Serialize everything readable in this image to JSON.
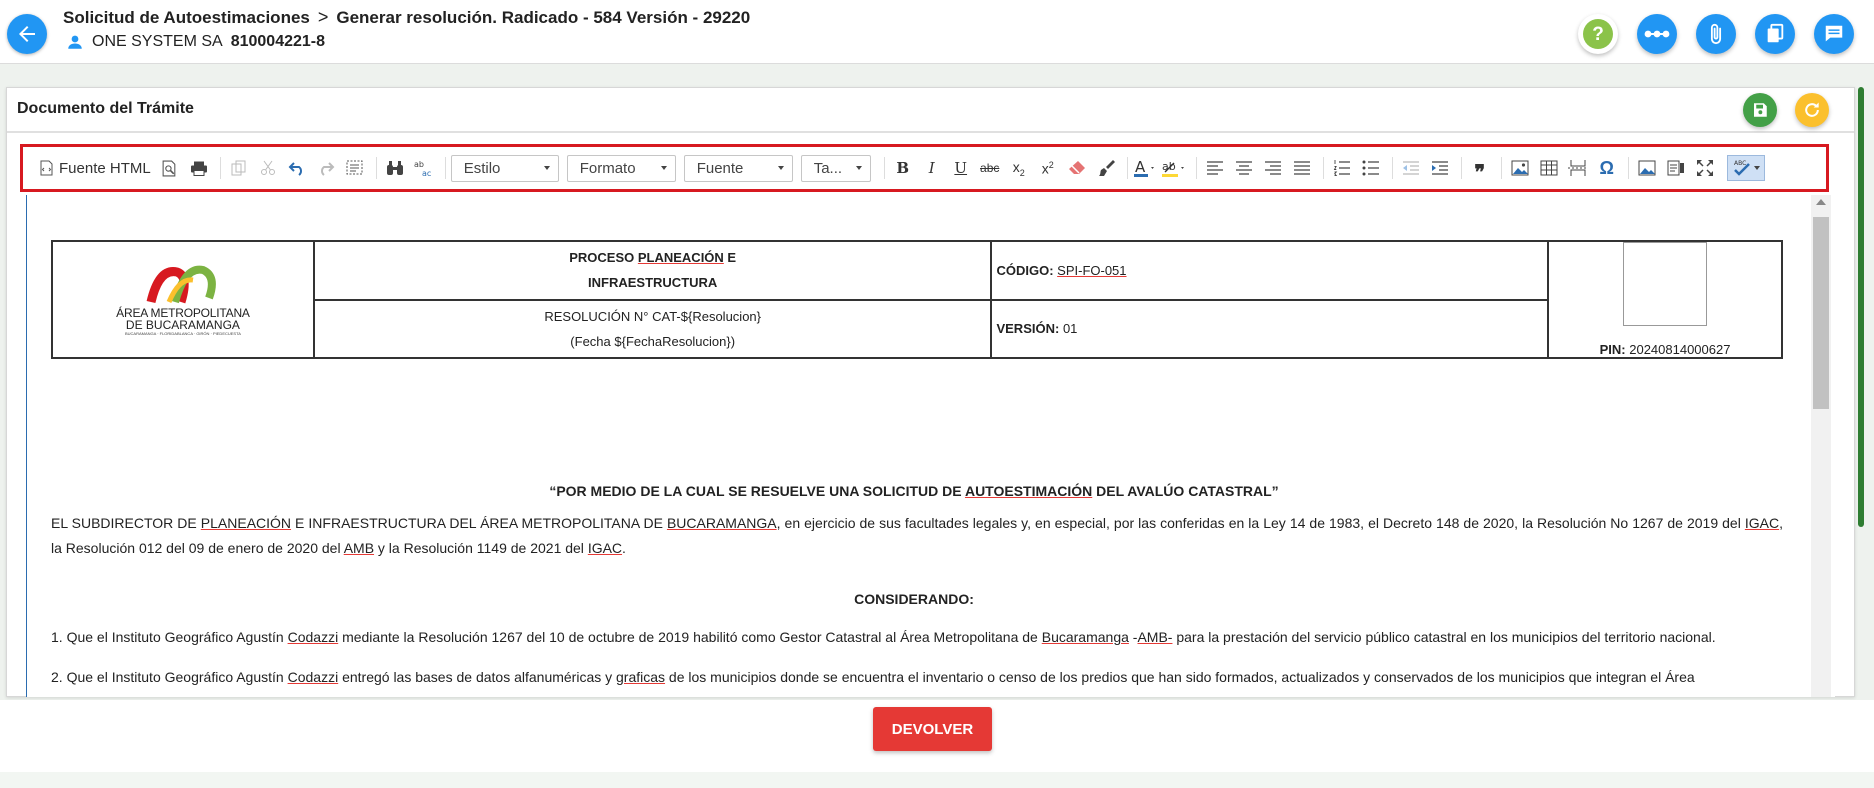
{
  "header": {
    "crumb_1": "Solicitud de Autoestimaciones",
    "crumb_sep": ">",
    "crumb_2": "Generar resolución. Radicado - 584 Versión - 29220",
    "company": "ONE SYSTEM SA",
    "nit": "810004221-8"
  },
  "panel": {
    "title": "Documento del Trámite"
  },
  "toolbar": {
    "source_label": "Fuente HTML",
    "style_label": "Estilo",
    "format_label": "Formato",
    "font_label": "Fuente",
    "size_label": "Ta..."
  },
  "doc": {
    "table": {
      "logo_line1": "ÁREA METROPOLITANA",
      "logo_line2": "DE BUCARAMANGA",
      "logo_small": "BUCARAMANGA · FLORIDABLANCA · GIRÓN · PIEDECUESTA",
      "proc_a": "PROCESO ",
      "proc_b": "PLANEACIÓN",
      "proc_c": " E",
      "proc_line2": "INFRAESTRUCTURA",
      "codigo_label": "CÓDIGO:",
      "codigo_value": "SPI-FO-051",
      "res_line1": "RESOLUCIÓN N° CAT-${Resolucion}",
      "res_line2": "(Fecha ${FechaResolucion})",
      "version_label": "VERSIÓN:",
      "version_value": "01",
      "pin_label": "PIN:",
      "pin_value": "20240814000627"
    },
    "title_a": "“POR MEDIO DE LA CUAL SE RESUELVE UNA SOLICITUD DE ",
    "title_b": "AUTOESTIMACIÓN",
    "title_c": " DEL AVALÚO CATASTRAL”",
    "p1_a": "EL SUBDIRECTOR DE ",
    "p1_b": "PLANEACIÓN",
    "p1_c": " E INFRAESTRUCTURA DEL ÁREA METROPOLITANA DE ",
    "p1_d": "BUCARAMANGA",
    "p1_e": ", en ejercicio de sus facultades legales y, en especial, por las conferidas en la Ley 14 de 1983, el Decreto 148 de 2020, la Resolución No 1267 de 2019 del ",
    "p1_f": "IGAC",
    "p1_g": ", la Resolución 012 del 09 de enero de 2020 del ",
    "p1_h": "AMB",
    "p1_i": " y la Resolución 1149 de 2021 del ",
    "p1_j": "IGAC",
    "p1_k": ".",
    "considerando": "CONSIDERANDO:",
    "p2_a": "1. Que el Instituto Geográfico Agustín ",
    "p2_b": "Codazzi",
    "p2_c": " mediante la Resolución 1267 del 10 de octubre de 2019 habilitó como Gestor Catastral al Área Metropolitana de ",
    "p2_d": "Bucaramanga",
    "p2_e": " -",
    "p2_f": "AMB-",
    "p2_g": " para la prestación del servicio público catastral en los municipios del territorio nacional.",
    "p3_a": "2. Que el Instituto Geográfico Agustín ",
    "p3_b": "Codazzi",
    "p3_c": " entregó las bases de datos alfanuméricas y ",
    "p3_d": "graficas",
    "p3_e": " de los municipios donde se encuentra el inventario o censo de los predios que han sido formados, actualizados y conservados de los municipios que integran el Área"
  },
  "footer": {
    "devolver_label": "DEVOLVER"
  },
  "colors": {
    "primary": "#2196f3",
    "danger": "#e53935",
    "success": "#43a047",
    "warning": "#fbc02d",
    "highlight": "#d71920",
    "help": "#8bc34a"
  }
}
